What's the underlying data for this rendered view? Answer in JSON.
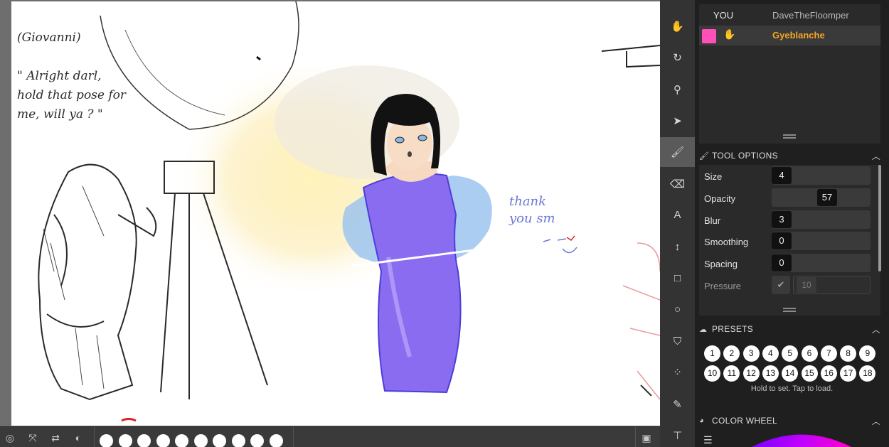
{
  "canvas": {
    "note_left": "(Giovanni)\n\n\" Alright darl,\nhold that pose for\nme, will ya ? \"",
    "note_right": "thank\nyou sm"
  },
  "bottom_bar": {
    "icons": [
      "target-icon",
      "fit-screen-icon",
      "swap-icon",
      "contrast-icon",
      "save-icon"
    ],
    "swatch_count": 10
  },
  "toolbar": {
    "tools": [
      {
        "name": "hand-tool",
        "glyph": "✋",
        "active": false
      },
      {
        "name": "rotate-tool",
        "glyph": "↻",
        "active": false
      },
      {
        "name": "eyedropper-tool",
        "glyph": "⚲",
        "active": false
      },
      {
        "name": "select-tool",
        "glyph": "➤",
        "active": false
      },
      {
        "name": "brush-tool",
        "glyph": "🖌",
        "active": true
      },
      {
        "name": "eraser-tool",
        "glyph": "⌫",
        "active": false
      },
      {
        "name": "text-tool",
        "glyph": "A",
        "active": false
      },
      {
        "name": "move-tool",
        "glyph": "↕",
        "active": false
      },
      {
        "name": "rectangle-tool",
        "glyph": "□",
        "active": false
      },
      {
        "name": "ellipse-tool",
        "glyph": "○",
        "active": false
      },
      {
        "name": "fill-tool",
        "glyph": "⛉",
        "active": false
      },
      {
        "name": "lasso-tool",
        "glyph": "⁘",
        "active": false
      },
      {
        "name": "pen-tool",
        "glyph": "✎",
        "active": false
      },
      {
        "name": "paint-roller-tool",
        "glyph": "⊤",
        "active": false
      }
    ]
  },
  "user_list": {
    "users": [
      {
        "label": "YOU",
        "name": "DaveTheFloomper"
      },
      {
        "label": "",
        "name": "Gyeblanche",
        "color": "#ff4fb8"
      }
    ]
  },
  "tool_options": {
    "title": "TOOL OPTIONS",
    "size": {
      "label": "Size",
      "value": "4",
      "fraction": 0.04
    },
    "opacity": {
      "label": "Opacity",
      "value": "57",
      "fraction": 0.57
    },
    "blur": {
      "label": "Blur",
      "value": "3",
      "fraction": 0.03
    },
    "smoothing": {
      "label": "Smoothing",
      "value": "0",
      "fraction": 0
    },
    "spacing": {
      "label": "Spacing",
      "value": "0",
      "fraction": 0
    },
    "pressure": {
      "label": "Pressure",
      "value": "10"
    }
  },
  "presets": {
    "title": "PRESETS",
    "row1": [
      "1",
      "2",
      "3",
      "4",
      "5",
      "6",
      "7",
      "8",
      "9"
    ],
    "row2": [
      "10",
      "11",
      "12",
      "13",
      "14",
      "15",
      "16",
      "17",
      "18"
    ],
    "hint": "Hold to set. Tap to load."
  },
  "color_wheel": {
    "title": "COLOR WHEEL"
  },
  "colors": {
    "accent": "#f5a623",
    "user_color": "#ff4fb8",
    "dress": "#8a6cf0"
  }
}
